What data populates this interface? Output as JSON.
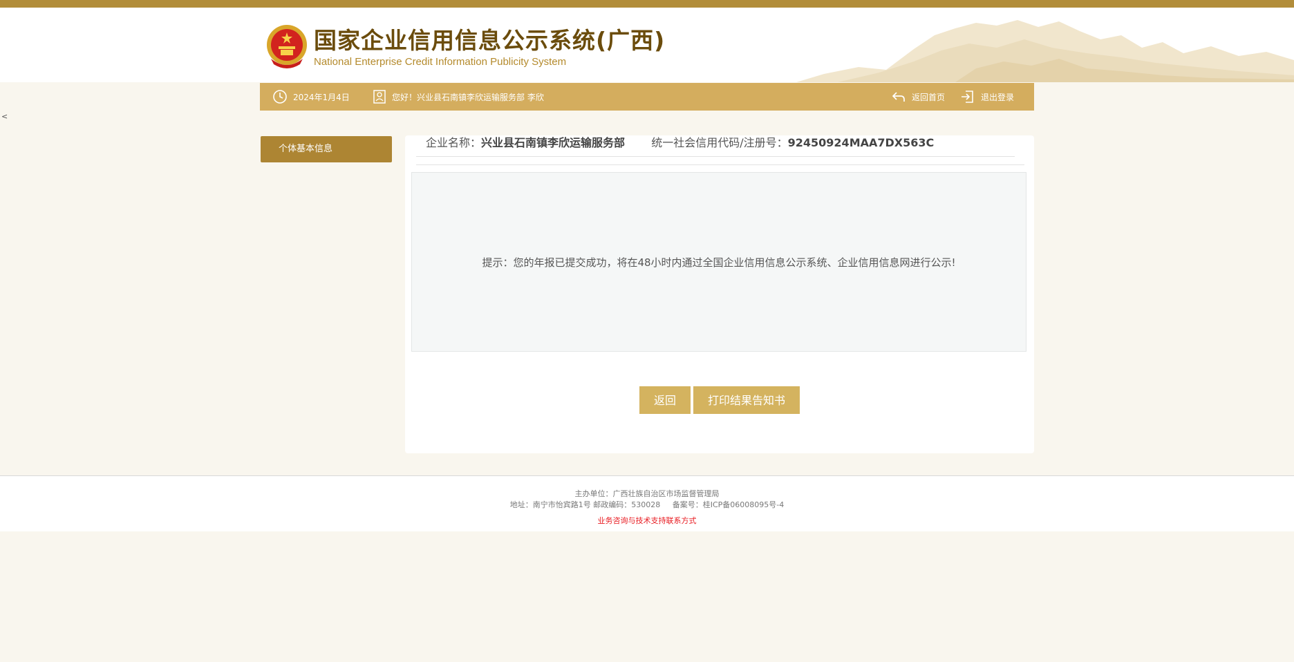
{
  "header": {
    "title": "国家企业信用信息公示系统(广西)",
    "subtitle": "National Enterprise Credit Information Publicity System"
  },
  "toolbar": {
    "date": "2024年1月4日",
    "greeting": "您好！兴业县石南镇李欣运输服务部  李欣",
    "home_label": "返回首页",
    "logout_label": "退出登录",
    "clock_icon": "clock-icon",
    "user_icon": "user-card-icon",
    "home_icon": "return-arrow-icon",
    "logout_icon": "logout-icon"
  },
  "back_link": "<",
  "sidebar": {
    "items": [
      {
        "label": "个体基本信息"
      }
    ]
  },
  "enterprise": {
    "name_label": "企业名称：",
    "name": "兴业县石南镇李欣运输服务部",
    "code_label": "统一社会信用代码/注册号：",
    "code": "92450924MAA7DX563C"
  },
  "notice": "提示：您的年报已提交成功，将在48小时内通过全国企业信用信息公示系统、企业信用信息网进行公示!",
  "buttons": {
    "back": "返回",
    "print": "打印结果告知书"
  },
  "footer": {
    "sponsor": "主办单位：广西壮族自治区市场监督管理局",
    "address": "地址：南宁市怡宾路1号 邮政编码：530028     备案号：桂ICP备06008095号-4",
    "contact": "业务咨询与技术支持联系方式"
  },
  "colors": {
    "accent": "#d4ad5e",
    "strip": "#b28d3a",
    "sidebar_active": "#ad8533",
    "title_brown": "#6b4c0c",
    "contact_red": "#e8191f"
  }
}
